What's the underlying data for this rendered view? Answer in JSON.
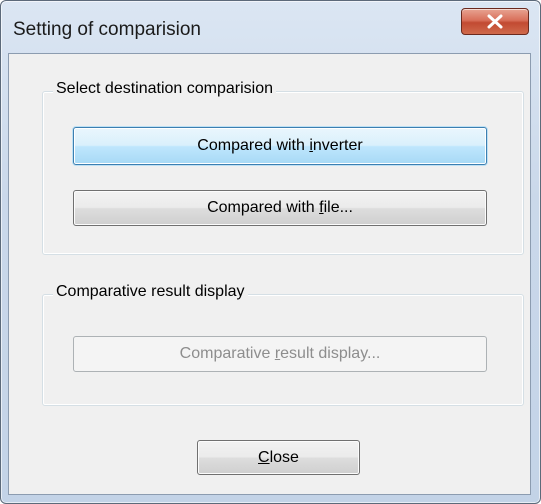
{
  "window": {
    "title": "Setting of comparision",
    "close_icon": "close-x-icon"
  },
  "group_destination": {
    "label": "Select destination comparision",
    "buttons": {
      "inverter": {
        "pre": "Compared with ",
        "u": "i",
        "post": "nverter"
      },
      "file": {
        "pre": "Compared with ",
        "u": "f",
        "post": "ile..."
      }
    }
  },
  "group_result": {
    "label": "Comparative result display",
    "button": {
      "pre": "Comparative ",
      "u": "r",
      "post": "esult display..."
    }
  },
  "close_button": {
    "pre": "",
    "u": "C",
    "post": "lose"
  },
  "colors": {
    "focus_border": "#3c7fb1",
    "disabled_text": "#8d8d8d",
    "close_red": "#c24a32"
  }
}
